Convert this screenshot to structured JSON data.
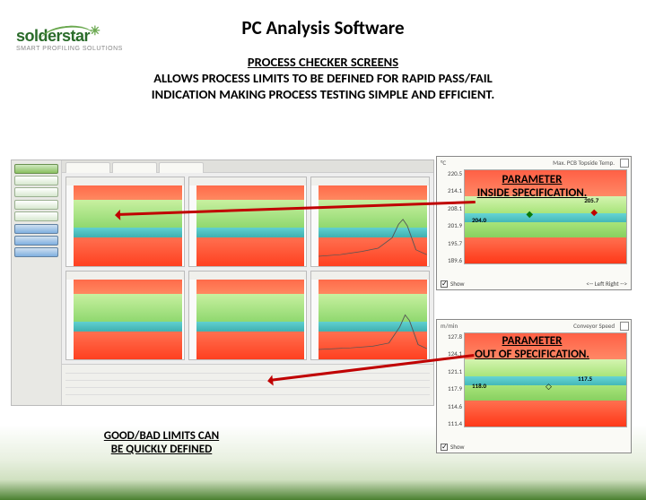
{
  "logo": {
    "brand": "solderstar",
    "tagline": "SMART PROFILING SOLUTIONS"
  },
  "title": "PC Analysis Software",
  "subtitle": "PROCESS CHECKER SCREENS",
  "description_line1": "ALLOWS PROCESS LIMITS TO BE DEFINED FOR RAPID PASS/FAIL",
  "description_line2": "INDICATION MAKING PROCESS TESTING SIMPLE AND EFFICIENT.",
  "annotations": {
    "inside_spec_l1": "PARAMETER",
    "inside_spec_l2": "INSIDE SPECIFICATION.",
    "out_spec_l1": "PARAMETER",
    "out_spec_l2": "OUT OF SPECIFICATION.",
    "limits_l1": "GOOD/BAD LIMITS CAN",
    "limits_l2": "BE QUICKLY DEFINED"
  },
  "detail_top": {
    "unit": "°C",
    "title_right": "Max. PCB Topside Temp.",
    "yticks": [
      "220.5",
      "214.1",
      "208.1",
      "201.9",
      "195.7",
      "189.6"
    ],
    "mid_value": "204.0",
    "marker_vals": [
      "205.7"
    ],
    "show_label": "Show",
    "foot_right": "<-- Left   Right -->"
  },
  "detail_bot": {
    "unit": "m/min",
    "title_right": "Conveyor Speed",
    "yticks": [
      "127.8",
      "124.1",
      "121.1",
      "117.9",
      "114.6",
      "111.4"
    ],
    "mid_value": "118.0",
    "marker_vals": [
      "117.5"
    ],
    "show_label": "Show"
  }
}
